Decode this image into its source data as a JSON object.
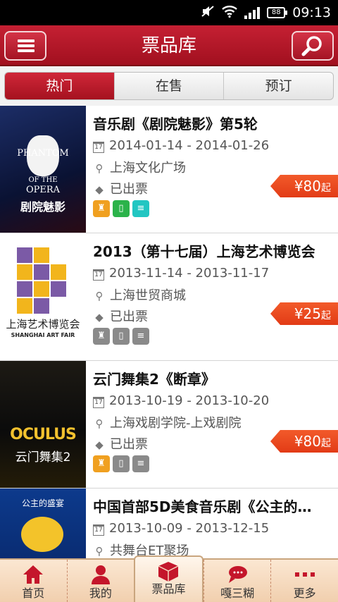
{
  "status_bar": {
    "time": "09:13",
    "battery": "88"
  },
  "header": {
    "title": "票品库"
  },
  "tabs": [
    {
      "label": "热门",
      "active": true
    },
    {
      "label": "在售",
      "active": false
    },
    {
      "label": "预订",
      "active": false
    }
  ],
  "events": [
    {
      "title": "音乐剧《剧院魅影》第5轮",
      "date": "2014-01-14 - 2014-01-26",
      "venue": "上海文化广场",
      "status": "已出票",
      "price": "¥80",
      "price_suffix": "起",
      "poster": {
        "lines": [
          "PHANTOM",
          "OF THE",
          "OPERA",
          "剧院魅影"
        ]
      }
    },
    {
      "title": "2013（第十七届）上海艺术博览会",
      "date": "2013-11-14 - 2013-11-17",
      "venue": "上海世贸商城",
      "status": "已出票",
      "price": "¥25",
      "price_suffix": "起",
      "poster": {
        "lines": [
          "上海艺术博览会",
          "SHANGHAI ART FAIR"
        ]
      }
    },
    {
      "title": "云门舞集2《断章》",
      "date": "2013-10-19 - 2013-10-20",
      "venue": "上海戏剧学院-上戏剧院",
      "status": "已出票",
      "price": "¥80",
      "price_suffix": "起",
      "poster": {
        "lines": [
          "OCULUS",
          "云门舞集2"
        ]
      }
    },
    {
      "title": "中国首部5D美食音乐剧《公主的…",
      "date": "2013-10-09 - 2013-12-15",
      "venue": "共舞台ET聚场",
      "status": "",
      "price": "",
      "price_suffix": "",
      "poster": {
        "lines": [
          "公主的盛宴"
        ]
      }
    }
  ],
  "bottom_nav": [
    {
      "label": "首页",
      "icon": "home-icon"
    },
    {
      "label": "我的",
      "icon": "user-icon"
    },
    {
      "label": "票品库",
      "icon": "box-icon",
      "active": true
    },
    {
      "label": "嘎三糊",
      "icon": "chat-icon"
    },
    {
      "label": "更多",
      "icon": "more-icon"
    }
  ],
  "colors": {
    "brand_red": "#b4172a",
    "price_orange": "#e8441c",
    "badge_orange": "#f0a020",
    "badge_green": "#2bb34a",
    "badge_cyan": "#22c6c2",
    "badge_grey": "#8a8a8a"
  }
}
